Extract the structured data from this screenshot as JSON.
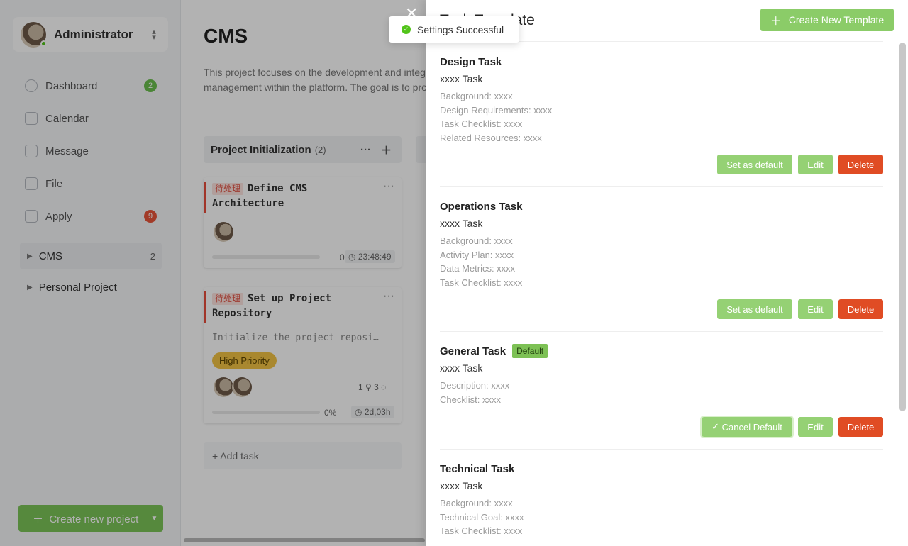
{
  "user": {
    "name": "Administrator"
  },
  "nav": [
    {
      "label": "Dashboard",
      "badge": "2",
      "icon": "dashboard-icon"
    },
    {
      "label": "Calendar",
      "badge": "",
      "icon": "calendar-icon"
    },
    {
      "label": "Message",
      "badge": "",
      "icon": "message-icon"
    },
    {
      "label": "File",
      "badge": "",
      "icon": "file-icon"
    },
    {
      "label": "Apply",
      "badge": "9",
      "icon": "apply-icon"
    }
  ],
  "projects": [
    {
      "name": "CMS",
      "count": "2"
    },
    {
      "name": "Personal Project",
      "count": ""
    }
  ],
  "create_project_label": "Create new project",
  "main": {
    "title": "CMS",
    "description": "This project focuses on the development and integ… management within the platform. The goal is to pro…"
  },
  "column": {
    "name": "Project Initialization",
    "count": "(2)"
  },
  "cards": [
    {
      "status": "待处理",
      "title": "Define CMS Architecture",
      "progress": "0%",
      "timer": "23:48:49"
    },
    {
      "status": "待处理",
      "title": "Set up Project Repository",
      "description": "Initialize the project reposi…",
      "priority": "High Priority",
      "links": "1",
      "comments": "3",
      "progress": "0%",
      "timer": "2d,03h"
    }
  ],
  "add_task_label": "+ Add task",
  "drawer": {
    "title": "Task Template",
    "create_label": "Create New Template",
    "templates": [
      {
        "name": "Design Task",
        "subtitle": "xxxx Task",
        "lines": [
          "Background: xxxx",
          "Design Requirements: xxxx",
          "Task Checklist: xxxx",
          "Related Resources: xxxx"
        ],
        "default_action": "Set as default",
        "edit": "Edit",
        "delete": "Delete"
      },
      {
        "name": "Operations Task",
        "subtitle": "xxxx Task",
        "lines": [
          "Background: xxxx",
          "Activity Plan: xxxx",
          "Data Metrics: xxxx",
          "Task Checklist: xxxx"
        ],
        "default_action": "Set as default",
        "edit": "Edit",
        "delete": "Delete"
      },
      {
        "name": "General Task",
        "tag": "Default",
        "subtitle": "xxxx Task",
        "lines": [
          "Description: xxxx",
          "Checklist: xxxx"
        ],
        "default_action": "Cancel Default",
        "edit": "Edit",
        "delete": "Delete"
      },
      {
        "name": "Technical Task",
        "subtitle": "xxxx Task",
        "lines": [
          "Background: xxxx",
          "Technical Goal: xxxx",
          "Task Checklist: xxxx"
        ]
      }
    ]
  },
  "toast": {
    "message": "Settings Successful"
  },
  "colors": {
    "brand_green": "#8bcc68",
    "danger": "#e04c24",
    "success": "#52c41a"
  }
}
